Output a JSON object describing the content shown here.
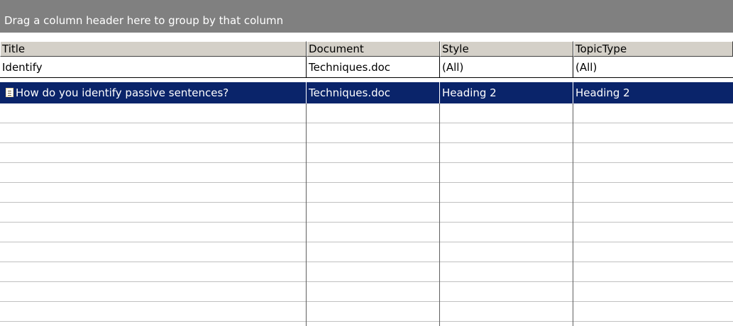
{
  "group_panel": {
    "text": "Drag a column header here to group by that column"
  },
  "columns": [
    {
      "label": "Title"
    },
    {
      "label": "Document"
    },
    {
      "label": "Style"
    },
    {
      "label": "TopicType"
    }
  ],
  "filter_row": {
    "title": "Identify",
    "document": "Techniques.doc",
    "style": "(All)",
    "topic_type": "(All)"
  },
  "rows": [
    {
      "icon": "document-icon",
      "title": "How do you identify passive sentences?",
      "document": "Techniques.doc",
      "style": "Heading 2",
      "topic_type": "Heading 2",
      "selected": true
    }
  ],
  "colors": {
    "group_bar": "#808080",
    "header": "#d4d0c8",
    "selection": "#0a246a"
  }
}
